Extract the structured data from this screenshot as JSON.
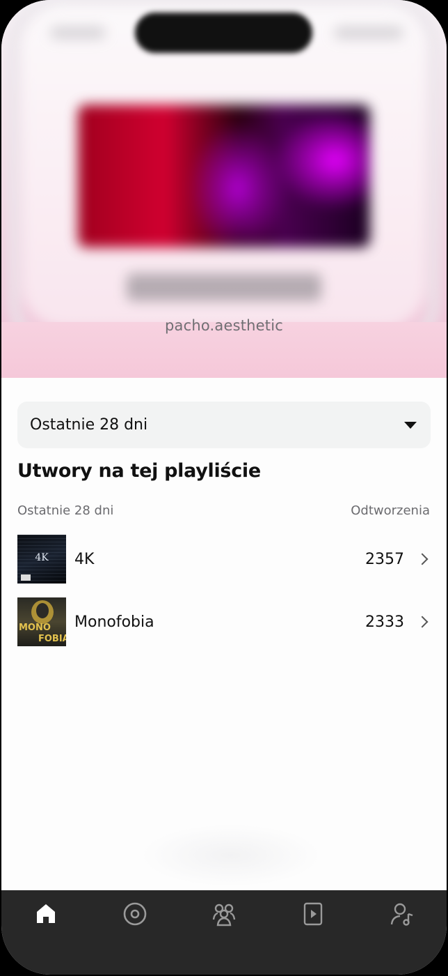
{
  "header": {
    "subtitle": "pacho.aesthetic"
  },
  "filter": {
    "selected": "Ostatnie 28 dni"
  },
  "section": {
    "title": "Utwory na tej playliście",
    "period_label": "Ostatnie 28 dni",
    "metric_label": "Odtworzenia"
  },
  "tracks": [
    {
      "name": "4K",
      "plays": "2357",
      "art_text": "4K"
    },
    {
      "name": "Monofobia",
      "plays": "2333",
      "art_text_1": "MONO",
      "art_text_2": "FOBIA"
    }
  ],
  "bottom_nav": {
    "items": [
      {
        "icon": "home-icon",
        "active": true
      },
      {
        "icon": "music-disc-icon",
        "active": false
      },
      {
        "icon": "audience-icon",
        "active": false
      },
      {
        "icon": "play-video-icon",
        "active": false
      },
      {
        "icon": "profile-music-icon",
        "active": false
      }
    ]
  },
  "colors": {
    "hero_pink": "#f5c8d9",
    "nav_background": "#282828",
    "nav_active": "#ffffff",
    "nav_inactive": "#9a9a9a"
  }
}
